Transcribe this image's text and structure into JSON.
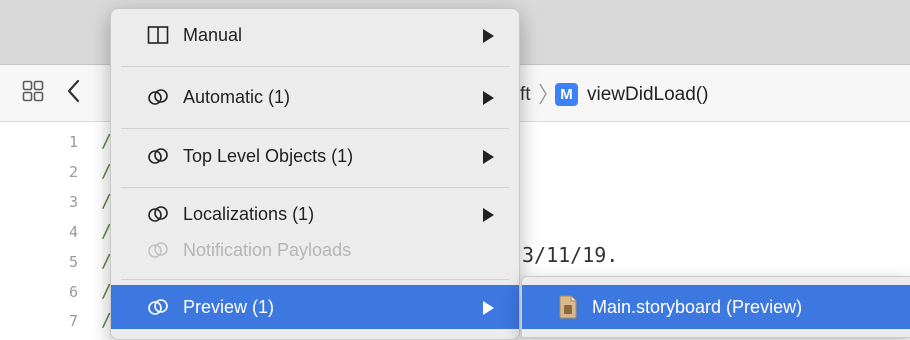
{
  "editor": {
    "breadcrumb_fragment": "ft",
    "method_badge": "M",
    "method_name": "viewDidLoad()",
    "line_numbers": [
      "1",
      "2",
      "3",
      "4",
      "5",
      "6",
      "7"
    ],
    "line_prefix": "/",
    "code_fragment": "3/11/19."
  },
  "menu": {
    "items": [
      {
        "label": "Manual",
        "icon": "split-pane-icon",
        "has_submenu": true
      },
      {
        "label": "Automatic (1)",
        "icon": "linked-circles-icon",
        "has_submenu": true
      },
      {
        "label": "Top Level Objects (1)",
        "icon": "linked-circles-icon",
        "has_submenu": true
      },
      {
        "label": "Localizations (1)",
        "icon": "linked-circles-icon",
        "has_submenu": true
      },
      {
        "label": "Notification Payloads",
        "icon": "linked-circles-icon",
        "has_submenu": false,
        "disabled": true
      },
      {
        "label": "Preview (1)",
        "icon": "linked-circles-icon",
        "has_submenu": true,
        "highlighted": true
      }
    ]
  },
  "submenu": {
    "items": [
      {
        "label": "Main.storyboard (Preview)",
        "icon": "storyboard-file-icon",
        "highlighted": true
      }
    ]
  },
  "colors": {
    "highlight": "#3d78e0",
    "menu_background": "#ececec",
    "method_badge": "#3b82f6"
  }
}
